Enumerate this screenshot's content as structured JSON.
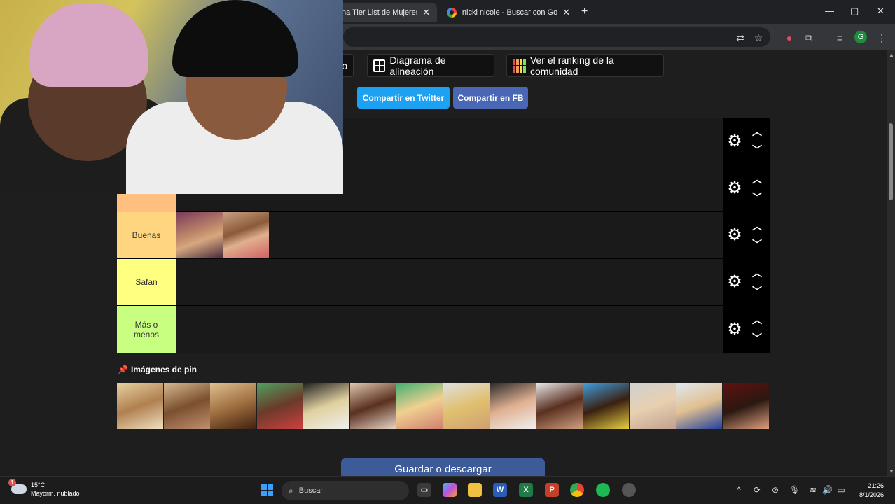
{
  "browser": {
    "tabs": [
      {
        "title": "na Tier List de Mujeres a",
        "active": true
      },
      {
        "title": "nicki nicole - Buscar con Googl",
        "active": false
      }
    ],
    "new_tab_label": "+",
    "tab_close": "✕",
    "window_controls": {
      "minimize": "—",
      "maximize": "▢",
      "close": "✕"
    },
    "profile_initial": "G"
  },
  "toolbar_buttons": {
    "partial_label": "o",
    "alignment_chart": "Diagrama de alineación",
    "community_ranking": "Ver el ranking de la comunidad"
  },
  "share": {
    "twitter": "Compartir en Twitter",
    "facebook": "Compartir en FB"
  },
  "tiers": [
    {
      "label": "",
      "color": "#1a1a1a",
      "images": 0
    },
    {
      "label": "",
      "color": "#1a1a1a",
      "images": 0
    },
    {
      "label": "Buenas",
      "color": "#ffd580",
      "images": 2
    },
    {
      "label": "Safan",
      "color": "#ffff80",
      "images": 0
    },
    {
      "label": "Más o\nmenos",
      "color": "#c8ff80",
      "images": 0
    }
  ],
  "pin_section": {
    "title": "Imágenes de pin",
    "image_count": 14
  },
  "save_button": "Guardar o descargar",
  "colors": {
    "twitter": "#1da1f2",
    "facebook": "#4a67b5",
    "orange_tier": "#ffbf7f"
  },
  "taskbar": {
    "weather_temp": "15°C",
    "weather_desc": "Mayorm. nublado",
    "weather_badge": "1",
    "search_placeholder": "Buscar",
    "time": "21:26",
    "date": "8/1/2026",
    "apps": [
      "file-explorer",
      "copilot",
      "folder",
      "word",
      "excel",
      "powerpoint",
      "chrome",
      "spotify",
      "other"
    ]
  }
}
